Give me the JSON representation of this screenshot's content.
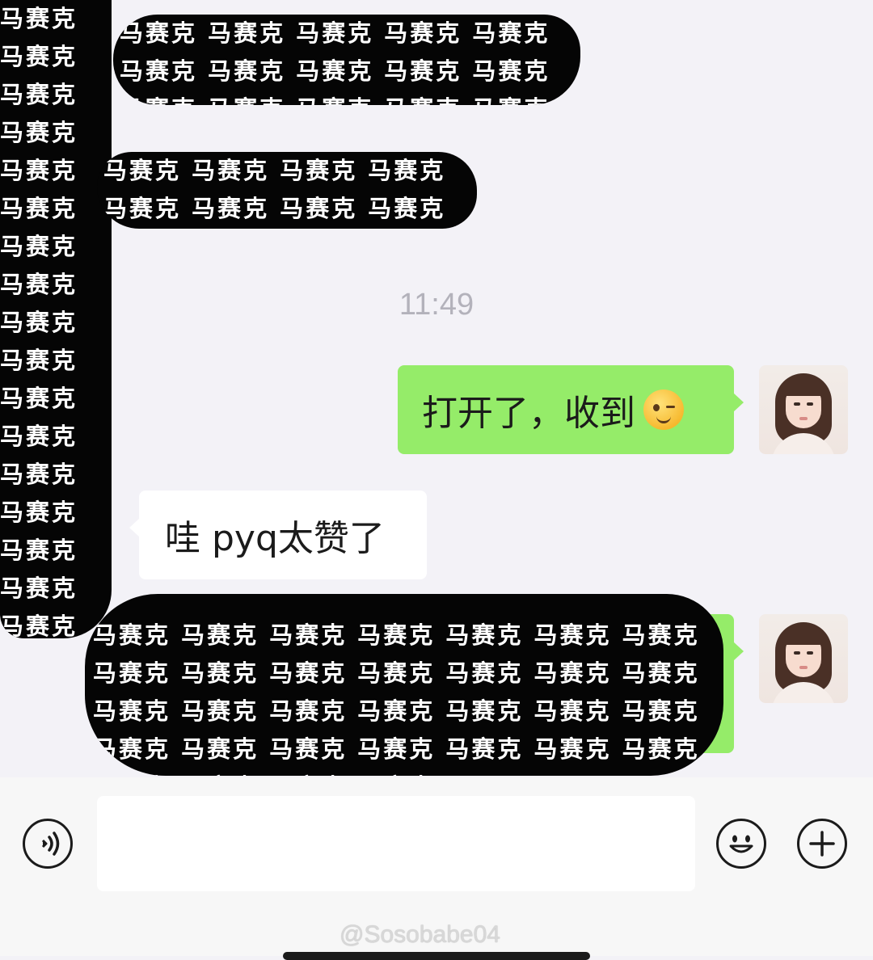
{
  "redaction_text": "马赛克 马赛克 马赛克 马赛克 马赛克 马赛克 马赛克 马赛克 马赛克 马赛克 马赛克 马赛克 马赛克 马赛克 马赛克 马赛克 马赛克 马赛克 马赛克 马赛克 马赛克 马赛克 马赛克 马赛克 马赛克 马赛克 马赛克 马赛克 马赛克 马赛克 马赛克 马赛克",
  "chat": {
    "timestamp": "11:49",
    "messages": [
      {
        "direction": "sent",
        "text": "打开了，收到",
        "emoji": "winking-face"
      },
      {
        "direction": "received",
        "text": "哇 pyq太赞了"
      },
      {
        "direction": "sent",
        "text": ""
      }
    ]
  },
  "input_bar": {
    "voice_icon": "voice-icon",
    "emoji_icon": "smiley-icon",
    "plus_icon": "plus-icon"
  },
  "watermark": "@Sosobabe04",
  "colors": {
    "chat_background": "#f3f2f7",
    "sent_bubble": "#95ec69",
    "received_bubble": "#ffffff",
    "timestamp_text": "#b3b2bb"
  }
}
